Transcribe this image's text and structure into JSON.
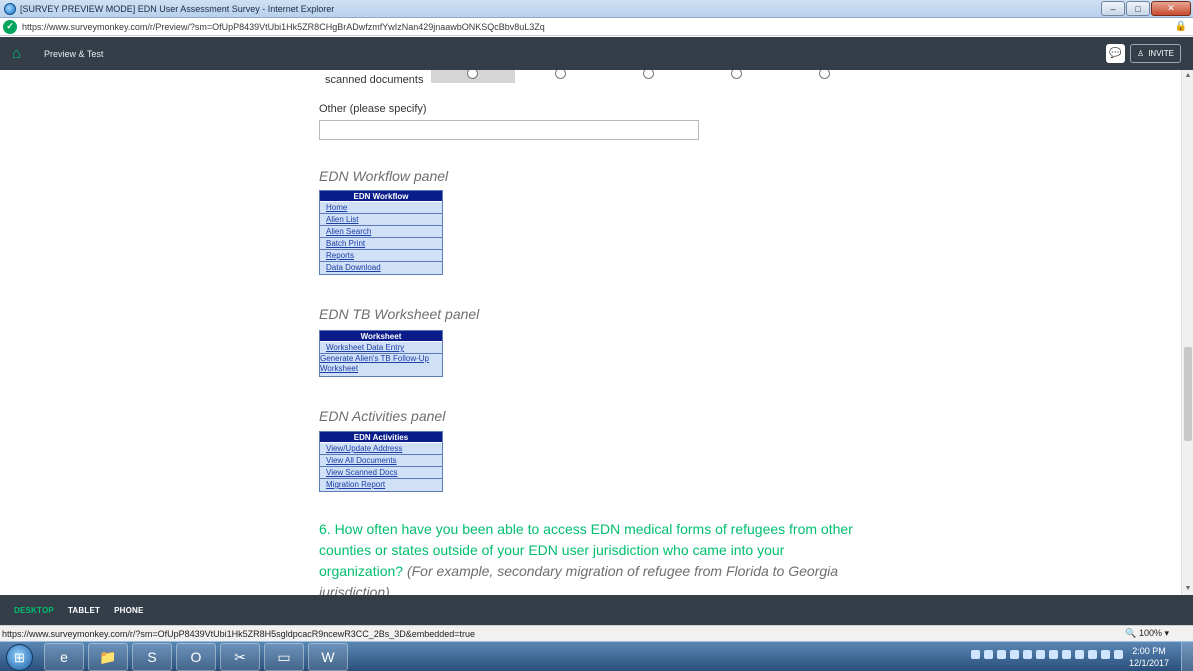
{
  "window": {
    "title": "[SURVEY PREVIEW MODE] EDN User Assessment Survey - Internet Explorer",
    "url": "https://www.surveymonkey.com/r/Preview/?sm=OfUpP8439VtUbi1Hk5ZR8CHgBrADwfzmfYwIzNan429jnaawbONKSQcBbv8uL3Zq",
    "controls": {
      "minimize": "–",
      "restore": "□",
      "close": "✕"
    }
  },
  "header": {
    "title": "Preview & Test",
    "invite_label": "INVITE"
  },
  "survey": {
    "previous_row_label": "scanned documents",
    "other_label": "Other (please specify)",
    "other_value": "",
    "panels": [
      {
        "section_title": "EDN Workflow panel",
        "header": "EDN Workflow",
        "items": [
          "Home",
          "Alien List",
          "Alien Search",
          "Batch Print",
          "Reports",
          "Data Download"
        ]
      },
      {
        "section_title": "EDN TB Worksheet panel",
        "header": "Worksheet",
        "items": [
          "Worksheet Data Entry",
          "Generate Alien's TB Follow-Up Worksheet"
        ]
      },
      {
        "section_title": "EDN Activities panel",
        "header": "EDN Activities",
        "items": [
          "View/Update Address",
          "View All Documents",
          "View Scanned Docs",
          "Migration Report"
        ]
      }
    ],
    "question": {
      "text": "6. How often have you been able to access EDN medical forms of refugees from other counties or states outside of your EDN user jurisdiction who came into your organization?",
      "hint": "(For example, secondary migration of refugee from Florida to Georgia jurisdiction)"
    }
  },
  "device_tabs": [
    "DESKTOP",
    "TABLET",
    "PHONE"
  ],
  "statusbar": {
    "url": "https://www.surveymonkey.com/r/?sm=OfUpP8439VtUbi1Hk5ZR8H5sgldpcacR9ncewR3CC_2Bs_3D&embedded=true",
    "zoom": "100%"
  },
  "taskbar": {
    "time": "2:00 PM",
    "date": "12/1/2017"
  }
}
